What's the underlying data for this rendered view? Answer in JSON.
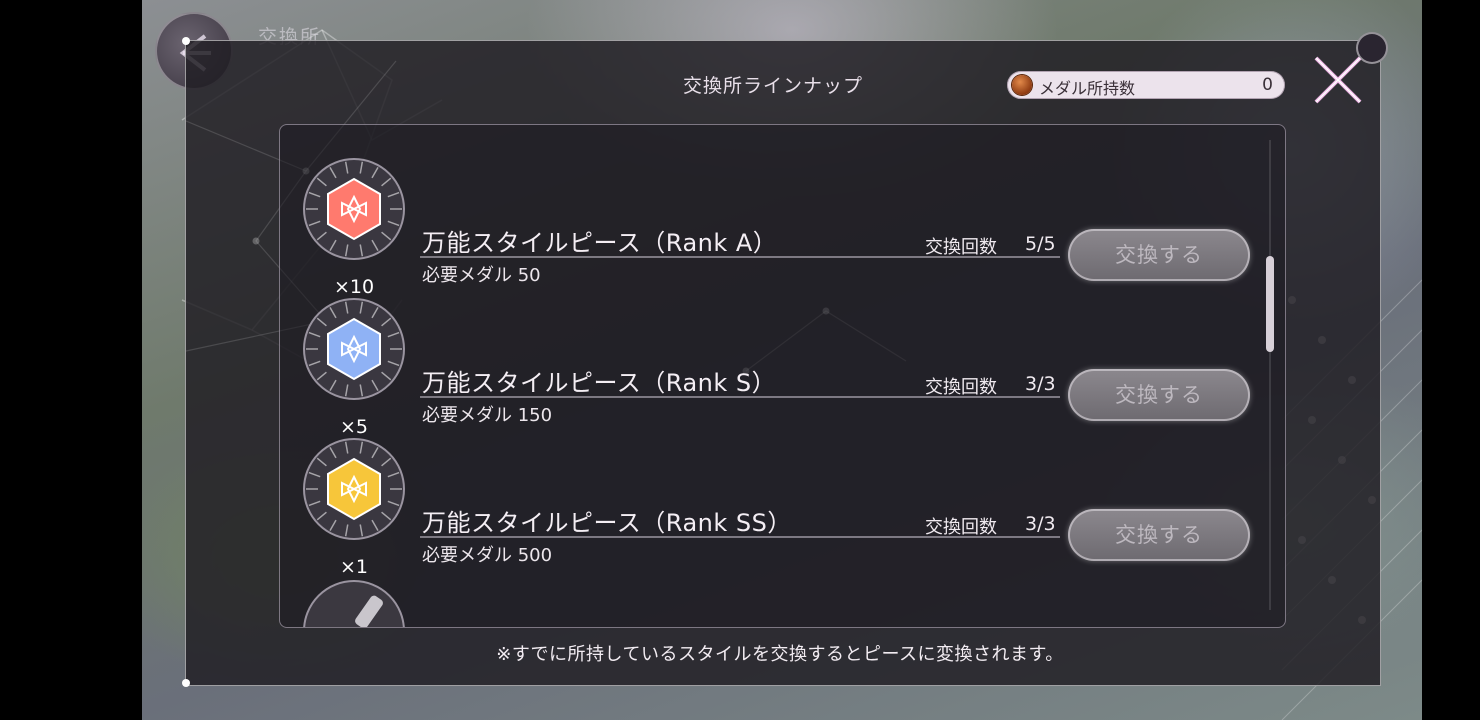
{
  "scene": {
    "title": "交換所"
  },
  "modal": {
    "title": "交換所ラインナップ",
    "medal": {
      "label": "メダル所持数",
      "value": "0",
      "icon": "medal-icon"
    },
    "close_icon": "close-icon"
  },
  "items": [
    {
      "name": "万能スタイルピース（Rank A）",
      "cost": "必要メダル 50",
      "count_label": "交換回数",
      "count_value": "5/5",
      "quantity": "×10",
      "button_label": "交換する",
      "gem_color": "#ff7a6e",
      "icon": "style-piece-icon"
    },
    {
      "name": "万能スタイルピース（Rank S）",
      "cost": "必要メダル 150",
      "count_label": "交換回数",
      "count_value": "3/3",
      "quantity": "×5",
      "button_label": "交換する",
      "gem_color": "#8fb2f5",
      "icon": "style-piece-icon"
    },
    {
      "name": "万能スタイルピース（Rank SS）",
      "cost": "必要メダル 500",
      "count_label": "交換回数",
      "count_value": "3/3",
      "quantity": "×1",
      "button_label": "交換する",
      "gem_color": "#f7c63a",
      "icon": "style-piece-icon"
    }
  ],
  "partial_item": {
    "icon": "key-item-icon"
  },
  "footnote": "※すでに所持しているスタイルを交換するとピースに変換されます。",
  "colors": {
    "modal_bg": "#201e24",
    "accent_text": "#f4eef4",
    "button_fill": "#7d7a80",
    "close_x": "#f0b8e8"
  }
}
